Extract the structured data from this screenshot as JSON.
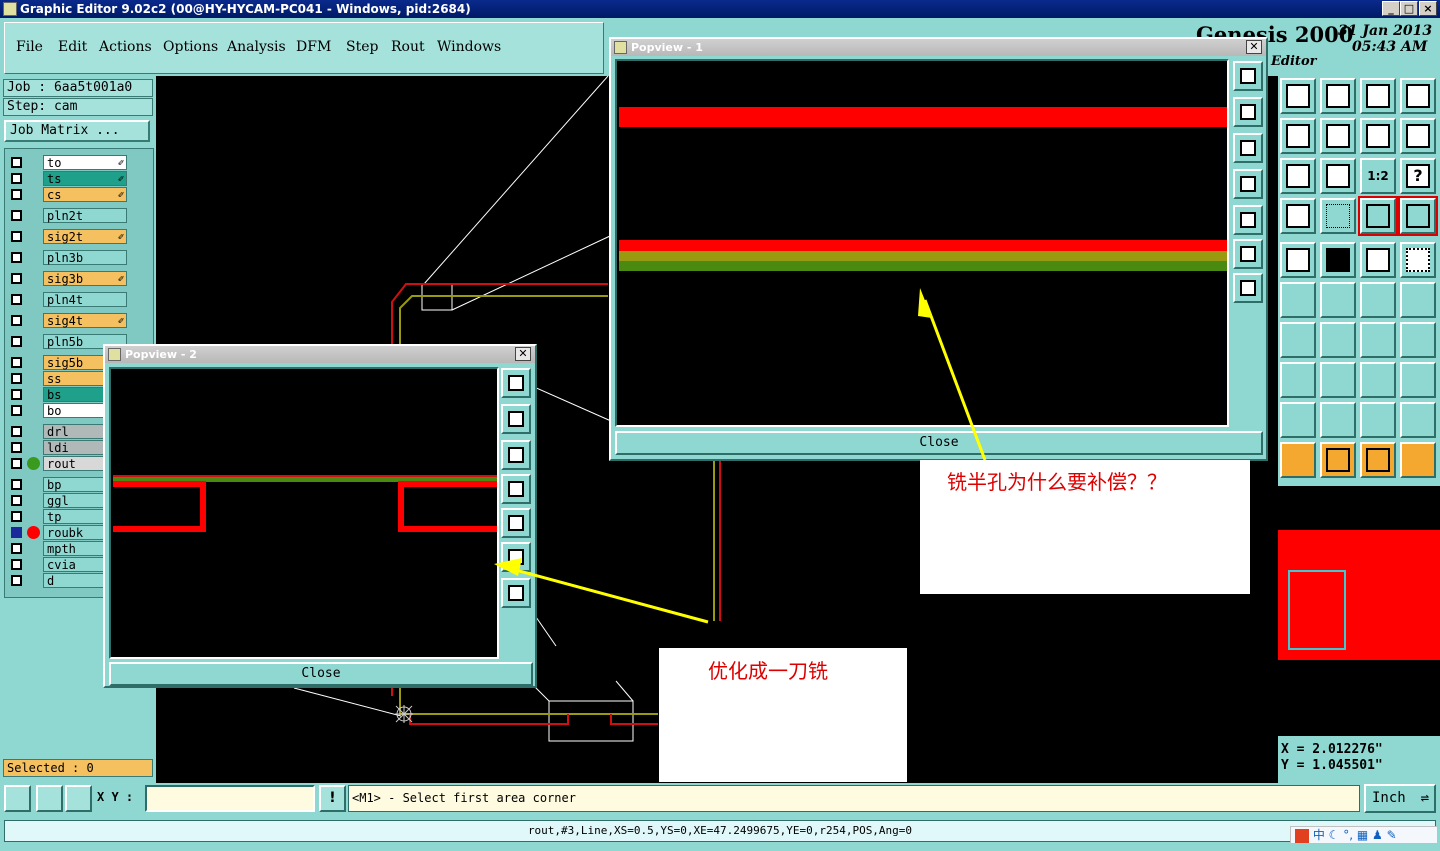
{
  "window": {
    "title": "Graphic Editor 9.02c2 (00@HY-HYCAM-PC041 - Windows, pid:2684)"
  },
  "menu": [
    "File",
    "Edit",
    "Actions",
    "Options",
    "Analysis",
    "DFM",
    "Step",
    "Rout",
    "Windows"
  ],
  "job": {
    "job_label": "Job  :  6aa5t001a0",
    "step_label": "Step:  cam",
    "matrix_button": "Job Matrix ..."
  },
  "layers": [
    {
      "name": "to",
      "color": "#ffffff",
      "mark": "✐"
    },
    {
      "name": "ts",
      "color": "#1fa08a",
      "mark": "✐"
    },
    {
      "name": "cs",
      "color": "#f5c060",
      "mark": "✐"
    },
    {
      "name": "pln2t",
      "color": "#8fd8d2",
      "mark": ""
    },
    {
      "name": "sig2t",
      "color": "#f5c060",
      "mark": "✐"
    },
    {
      "name": "pln3b",
      "color": "#8fd8d2",
      "mark": ""
    },
    {
      "name": "sig3b",
      "color": "#f5c060",
      "mark": "✐"
    },
    {
      "name": "pln4t",
      "color": "#8fd8d2",
      "mark": ""
    },
    {
      "name": "sig4t",
      "color": "#f5c060",
      "mark": "✐"
    },
    {
      "name": "pln5b",
      "color": "#8fd8d2",
      "mark": ""
    },
    {
      "name": "sig5b",
      "color": "#f5c060",
      "mark": ""
    },
    {
      "name": "ss",
      "color": "#f5c060",
      "mark": ""
    },
    {
      "name": "bs",
      "color": "#1fa08a",
      "mark": ""
    },
    {
      "name": "bo",
      "color": "#ffffff",
      "mark": ""
    },
    {
      "name": "drl",
      "color": "#b0b8b8",
      "mark": ""
    },
    {
      "name": "ldi",
      "color": "#b0b8b8",
      "mark": ""
    },
    {
      "name": "rout",
      "color": "#d8d8d8",
      "mark": ""
    },
    {
      "name": "bp",
      "color": "#8fd8d2",
      "mark": ""
    },
    {
      "name": "ggl",
      "color": "#8fd8d2",
      "mark": ""
    },
    {
      "name": "tp",
      "color": "#8fd8d2",
      "mark": ""
    },
    {
      "name": "roubk",
      "color": "#8fd8d2",
      "mark": ""
    },
    {
      "name": "mpth",
      "color": "#8fd8d2",
      "mark": ""
    },
    {
      "name": "cvia",
      "color": "#8fd8d2",
      "mark": ""
    },
    {
      "name": "d",
      "color": "#8fd8d2",
      "mark": ""
    }
  ],
  "selected": "Selected : 0",
  "genesis": {
    "brand": "Genesis 2000",
    "date": "31 Jan 2013",
    "time": "05:43 AM",
    "subtitle": "Editor"
  },
  "coords": {
    "x": "X  =  2.012276\"",
    "y": "Y  =  1.045501\""
  },
  "xy_label": "X Y :",
  "prompt": "<M1> - Select first area corner",
  "units": "Inch",
  "status": "rout,#3,Line,XS=0.5,YS=0,XE=47.2499675,YE=0,r254,POS,Ang=0",
  "popup1": {
    "title": "Popview - 1",
    "close": "Close"
  },
  "popup2": {
    "title": "Popview - 2",
    "close": "Close"
  },
  "notes": {
    "question": "铣半孔为什么要补偿？？",
    "answer": "优化成一刀铣"
  },
  "tray": {
    "ime": "中"
  },
  "colors": {
    "teal": "#8fd8d2",
    "red": "#ff0000",
    "yellow": "#ffff00",
    "olive": "#9a9a10",
    "green": "#4a8a10"
  }
}
